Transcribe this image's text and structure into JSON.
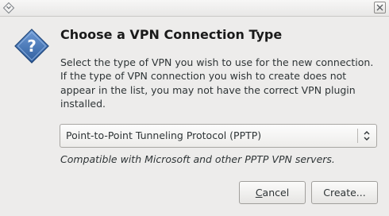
{
  "window": {
    "title_icon": "window-menu-icon",
    "close_icon": "close-icon"
  },
  "dialog": {
    "icon": "question-icon",
    "title": "Choose a VPN Connection Type",
    "description": "Select the type of VPN you wish to use for the new connection.  If the type of VPN connection you wish to create does not appear in the list, you may not have the correct VPN plugin installed.",
    "vpn_type": {
      "selected": "Point-to-Point Tunneling Protocol (PPTP)"
    },
    "hint": "Compatible with Microsoft and other PPTP VPN servers.",
    "buttons": {
      "cancel_mnemonic": "C",
      "cancel_rest": "ancel",
      "create": "Create..."
    }
  },
  "colors": {
    "background": "#edeceb",
    "icon_blue": "#3b6fb5",
    "text": "#2e3436"
  }
}
